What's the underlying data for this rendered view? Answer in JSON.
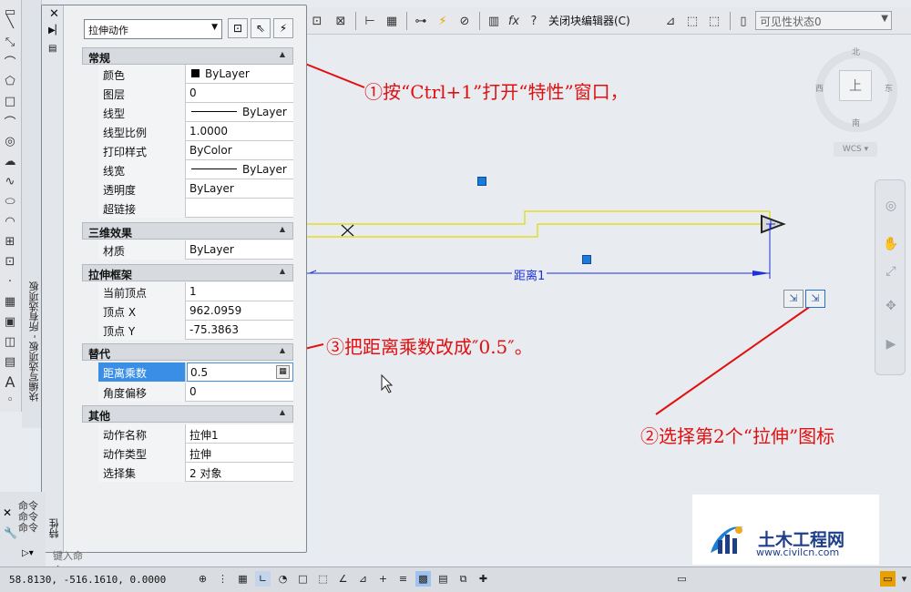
{
  "toolbar": {
    "close_block_editor": "关闭块编辑器(C)",
    "visibility_state": "可见性状态0"
  },
  "left_palette": {
    "title": "块编写选项板 - 所有选项板"
  },
  "properties": {
    "type_value": "拉伸动作",
    "panel_label": "特性",
    "sections": {
      "general": {
        "title": "常规",
        "rows": [
          {
            "key": "颜色",
            "value": "ByLayer"
          },
          {
            "key": "图层",
            "value": "0"
          },
          {
            "key": "线型",
            "value": "ByLayer"
          },
          {
            "key": "线型比例",
            "value": "1.0000"
          },
          {
            "key": "打印样式",
            "value": "ByColor"
          },
          {
            "key": "线宽",
            "value": "ByLayer"
          },
          {
            "key": "透明度",
            "value": "ByLayer"
          },
          {
            "key": "超链接",
            "value": ""
          }
        ]
      },
      "three_d": {
        "title": "三维效果",
        "rows": [
          {
            "key": "材质",
            "value": "ByLayer"
          }
        ]
      },
      "stretch_frame": {
        "title": "拉伸框架",
        "rows": [
          {
            "key": "当前顶点",
            "value": "1"
          },
          {
            "key": "顶点 X",
            "value": "962.0959"
          },
          {
            "key": "顶点 Y",
            "value": "-75.3863"
          }
        ]
      },
      "override": {
        "title": "替代",
        "rows": [
          {
            "key": "距离乘数",
            "value": "0.5"
          },
          {
            "key": "角度偏移",
            "value": "0"
          }
        ]
      },
      "other": {
        "title": "其他",
        "rows": [
          {
            "key": "动作名称",
            "value": "拉伸1"
          },
          {
            "key": "动作类型",
            "value": "拉伸"
          },
          {
            "key": "选择集",
            "value": "2 对象"
          }
        ]
      }
    }
  },
  "canvas": {
    "distance_label": "距离1"
  },
  "viewcube": {
    "north": "北",
    "south": "南",
    "west": "西",
    "east": "东",
    "face": "上",
    "wcs": "WCS"
  },
  "command": {
    "line1": "命令",
    "line2": "命令",
    "line3": "命令",
    "prompt": "键入命令"
  },
  "statusbar": {
    "coords": "58.8130,   -516.1610, 0.0000"
  },
  "annotations": {
    "a1": "①按“Ctrl+1”打开“特性”窗口，",
    "a2": "②选择第2个“拉伸”图标",
    "a3": "③把距离乘数改成″0.5″。"
  },
  "logo": {
    "name": "土木工程网",
    "url": "www.civilcn.com"
  },
  "colors": {
    "annotation": "#e11010",
    "dimension": "#1b30d8",
    "geometry": "#e3d800",
    "grip": "#1a7bd8",
    "selection": "#3a8ee6"
  }
}
